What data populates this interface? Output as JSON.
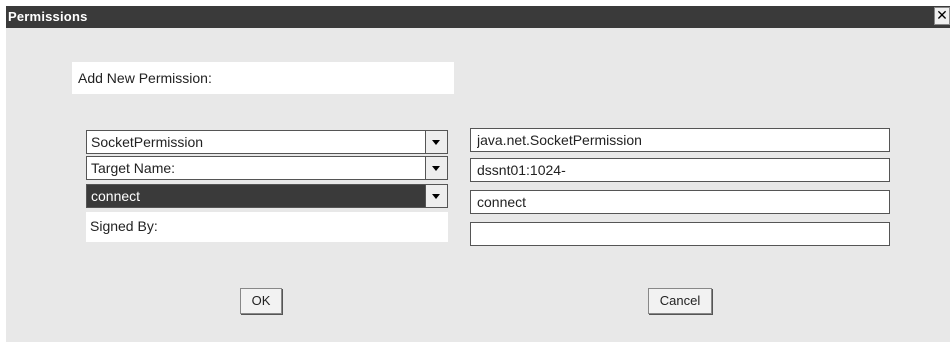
{
  "window": {
    "title": "Permissions",
    "close_glyph": "✕"
  },
  "section_label": "Add New Permission:",
  "permission_type": {
    "selected": "SocketPermission",
    "class_name": "java.net.SocketPermission"
  },
  "target": {
    "selected": "Target Name:",
    "value": "dssnt01:1024-"
  },
  "actions": {
    "selected": "connect",
    "value": "connect"
  },
  "signed_by": {
    "label": "Signed By:",
    "value": ""
  },
  "buttons": {
    "ok": "OK",
    "cancel": "Cancel"
  },
  "colors": {
    "titlebar": "#3a3a3a",
    "dialog_bg": "#e8e8e8",
    "selected_bg": "#3a3a3a"
  },
  "icons": {
    "close": "close-icon",
    "dropdown": "chevron-down-icon"
  }
}
